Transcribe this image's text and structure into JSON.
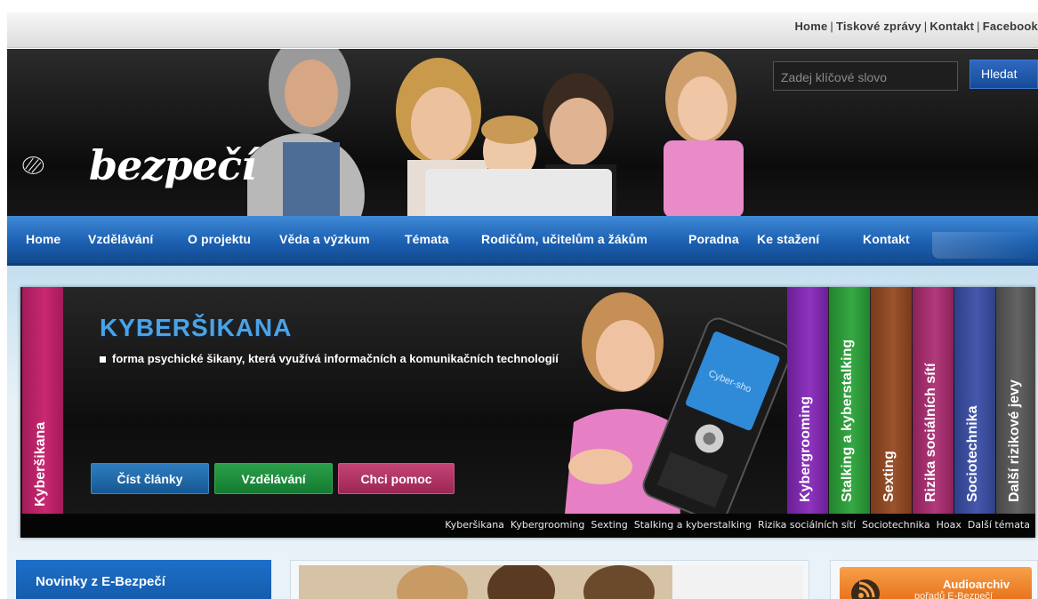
{
  "top_links": [
    "Home",
    "Tiskové zprávy",
    "Kontakt",
    "Facebook"
  ],
  "logo": {
    "text": "bezpečí"
  },
  "search": {
    "placeholder": "Zadej klíčové slovo",
    "button": "Hledat"
  },
  "nav": [
    "Home",
    "Vzdělávání",
    "O projektu",
    "Věda a výzkum",
    "Témata",
    "Rodičům, učitelům a žákům",
    "Poradna",
    "Ke stažení",
    "Kontakt"
  ],
  "panel": {
    "active_tab": "Kyberšikana",
    "title": "KYBERŠIKANA",
    "bullet": "forma psychické šikany, která využívá informačních a komunikačních technologií",
    "buttons": [
      "Číst články",
      "Vzdělávání",
      "Chci pomoc"
    ],
    "phone_screen_text": "Cyber-sho",
    "topic_tabs": [
      {
        "label": "Kybergrooming",
        "color": "#7d2aa8"
      },
      {
        "label": "Stalking a kyberstalking",
        "color": "#2f9a3b"
      },
      {
        "label": "Sexting",
        "color": "#8e4523"
      },
      {
        "label": "Rizika sociálních sítí",
        "color": "#a12a6a"
      },
      {
        "label": "Sociotechnika",
        "color": "#3b4d9a"
      },
      {
        "label": "Další rizikové jevy",
        "color": "#555555"
      }
    ],
    "bottom_links": [
      "Kyberšikana",
      "Kybergrooming",
      "Sexting",
      "Stalking a kyberstalking",
      "Rizika sociálních sítí",
      "Sociotechnika",
      "Hoax",
      "Další témata"
    ]
  },
  "news": {
    "title": "Novinky z E-Bezpečí"
  },
  "audio": {
    "title": "Audioarchiv",
    "subtitle": "pořadů E-Bezpečí"
  },
  "colors": {
    "nav_blue": "#1c60b2",
    "accent_title": "#4aa3e6",
    "active_tab": "#c92872"
  }
}
